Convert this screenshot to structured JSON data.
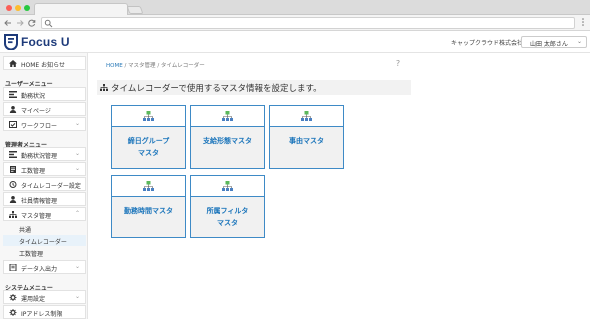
{
  "browser": {
    "back_icon": "arrow-left-icon",
    "forward_icon": "arrow-right-icon",
    "reload_icon": "reload-icon",
    "search_icon": "magnifier-icon",
    "menu_icon": "kebab-icon"
  },
  "header": {
    "logo_text": "Focus U",
    "company": "キャップクラウド株式会社",
    "user": "山田 太郎さん",
    "brand_color": "#1d3a7a"
  },
  "sidebar": {
    "home": "HOME お知らせ",
    "user_menu_heading": "ユーザーメニュー",
    "user_items": [
      "勤務状況",
      "マイページ",
      "ワークフロー"
    ],
    "admin_menu_heading": "管理者メニュー",
    "admin_items": [
      "勤務状況管理",
      "工数管理",
      "タイムレコーダー設定",
      "社員情報管理",
      "マスタ管理"
    ],
    "master_sub": [
      "共通",
      "タイムレコーダー",
      "工数管理"
    ],
    "data_io": "データ入出力",
    "system_menu_heading": "システムメニュー",
    "system_items": [
      "運用設定",
      "IPアドレス制限"
    ]
  },
  "breadcrumb": {
    "home": "HOME",
    "sep": "/",
    "level1": "マスタ管理",
    "level2": "タイムレコーダー"
  },
  "page": {
    "title": "タイムレコーダーで使用するマスタ情報を設定します。",
    "help": "?"
  },
  "cards": [
    {
      "line1": "締日グループ",
      "line2": "マスタ"
    },
    {
      "line1": "支給形態マスタ",
      "line2": ""
    },
    {
      "line1": "事由マスタ",
      "line2": ""
    },
    {
      "line1": "勤務時間マスタ",
      "line2": ""
    },
    {
      "line1": "所属フィルタ",
      "line2": "マスタ"
    }
  ],
  "colors": {
    "accent": "#1b75bb",
    "card_border": "#3e8ac6",
    "icon_green": "#5cb85c",
    "icon_blue": "#4a7fc1"
  }
}
